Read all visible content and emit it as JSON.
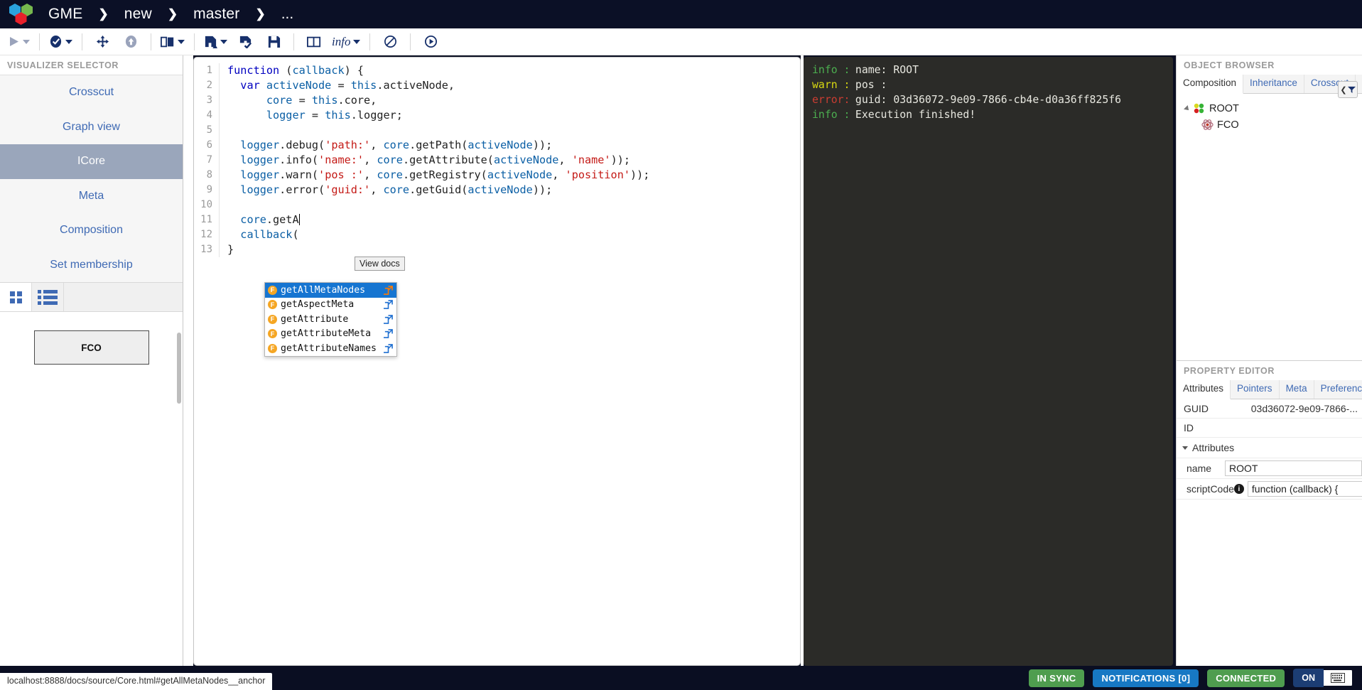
{
  "navbar": {
    "brand": "GME",
    "breadcrumb": [
      "new",
      "master"
    ],
    "overflow": "...",
    "separator": "❯"
  },
  "toolbar": {
    "buttons": [
      {
        "name": "execute-button",
        "icon": "play-icon",
        "label": "",
        "caret": true,
        "disabled": true
      },
      {
        "name": "validate-button",
        "icon": "check-circle-icon",
        "label": "",
        "caret": true,
        "disabled": false
      },
      {
        "name": "move-button",
        "icon": "move-arrows-icon",
        "label": "",
        "caret": false,
        "disabled": false
      },
      {
        "name": "upload-button",
        "icon": "up-circle-icon",
        "label": "",
        "caret": false,
        "disabled": true
      },
      {
        "name": "split-view-button",
        "icon": "split-panel-icon",
        "label": "",
        "caret": true,
        "disabled": false
      },
      {
        "name": "save-as-button",
        "icon": "save-up-icon",
        "label": "",
        "caret": true,
        "disabled": false
      },
      {
        "name": "save-check-button",
        "icon": "save-check-icon",
        "label": "",
        "caret": false,
        "disabled": false
      },
      {
        "name": "save-button",
        "icon": "floppy-save-icon",
        "label": "",
        "caret": false,
        "disabled": false
      },
      {
        "name": "layout-button",
        "icon": "two-column-icon",
        "label": "",
        "caret": false,
        "disabled": false
      },
      {
        "name": "log-level-button",
        "icon": "",
        "label": "info",
        "caret": true,
        "disabled": false
      },
      {
        "name": "clear-console-button",
        "icon": "no-entry-icon",
        "label": "",
        "caret": false,
        "disabled": false
      },
      {
        "name": "run-button",
        "icon": "play-circle-icon",
        "label": "",
        "caret": false,
        "disabled": false
      }
    ]
  },
  "left_panel": {
    "title": "VISUALIZER SELECTOR",
    "items": [
      {
        "label": "Crosscut",
        "active": false
      },
      {
        "label": "Graph view",
        "active": false
      },
      {
        "label": "ICore",
        "active": true
      },
      {
        "label": "Meta",
        "active": false
      },
      {
        "label": "Composition",
        "active": false
      },
      {
        "label": "Set membership",
        "active": false
      }
    ],
    "mode_tabs": [
      {
        "name": "grid-view-tab",
        "icon": "grid-icon",
        "active": true
      },
      {
        "name": "list-view-tab",
        "icon": "list-icon",
        "active": false
      }
    ],
    "node_box": "FCO"
  },
  "editor": {
    "lines": [
      {
        "n": "1",
        "tokens": [
          {
            "t": "function ",
            "c": "k-kw"
          },
          {
            "t": "(",
            "c": "k-plain"
          },
          {
            "t": "callback",
            "c": "k-var"
          },
          {
            "t": ") {",
            "c": "k-plain"
          }
        ]
      },
      {
        "n": "2",
        "tokens": [
          {
            "t": "  ",
            "c": "k-plain"
          },
          {
            "t": "var ",
            "c": "k-kw"
          },
          {
            "t": "activeNode",
            "c": "k-var"
          },
          {
            "t": " = ",
            "c": "k-plain"
          },
          {
            "t": "this",
            "c": "k-this"
          },
          {
            "t": ".activeNode,",
            "c": "k-plain"
          }
        ]
      },
      {
        "n": "3",
        "tokens": [
          {
            "t": "      ",
            "c": "k-plain"
          },
          {
            "t": "core",
            "c": "k-var"
          },
          {
            "t": " = ",
            "c": "k-plain"
          },
          {
            "t": "this",
            "c": "k-this"
          },
          {
            "t": ".core,",
            "c": "k-plain"
          }
        ]
      },
      {
        "n": "4",
        "tokens": [
          {
            "t": "      ",
            "c": "k-plain"
          },
          {
            "t": "logger",
            "c": "k-var"
          },
          {
            "t": " = ",
            "c": "k-plain"
          },
          {
            "t": "this",
            "c": "k-this"
          },
          {
            "t": ".logger;",
            "c": "k-plain"
          }
        ]
      },
      {
        "n": "5",
        "tokens": [
          {
            "t": "",
            "c": "k-plain"
          }
        ]
      },
      {
        "n": "6",
        "tokens": [
          {
            "t": "  ",
            "c": "k-plain"
          },
          {
            "t": "logger",
            "c": "k-var"
          },
          {
            "t": ".debug(",
            "c": "k-plain"
          },
          {
            "t": "'path:'",
            "c": "k-str"
          },
          {
            "t": ", ",
            "c": "k-plain"
          },
          {
            "t": "core",
            "c": "k-var"
          },
          {
            "t": ".getPath(",
            "c": "k-plain"
          },
          {
            "t": "activeNode",
            "c": "k-var"
          },
          {
            "t": "));",
            "c": "k-plain"
          }
        ]
      },
      {
        "n": "7",
        "tokens": [
          {
            "t": "  ",
            "c": "k-plain"
          },
          {
            "t": "logger",
            "c": "k-var"
          },
          {
            "t": ".info(",
            "c": "k-plain"
          },
          {
            "t": "'name:'",
            "c": "k-str"
          },
          {
            "t": ", ",
            "c": "k-plain"
          },
          {
            "t": "core",
            "c": "k-var"
          },
          {
            "t": ".getAttribute(",
            "c": "k-plain"
          },
          {
            "t": "activeNode",
            "c": "k-var"
          },
          {
            "t": ", ",
            "c": "k-plain"
          },
          {
            "t": "'name'",
            "c": "k-str"
          },
          {
            "t": "));",
            "c": "k-plain"
          }
        ]
      },
      {
        "n": "8",
        "tokens": [
          {
            "t": "  ",
            "c": "k-plain"
          },
          {
            "t": "logger",
            "c": "k-var"
          },
          {
            "t": ".warn(",
            "c": "k-plain"
          },
          {
            "t": "'pos :'",
            "c": "k-str"
          },
          {
            "t": ", ",
            "c": "k-plain"
          },
          {
            "t": "core",
            "c": "k-var"
          },
          {
            "t": ".getRegistry(",
            "c": "k-plain"
          },
          {
            "t": "activeNode",
            "c": "k-var"
          },
          {
            "t": ", ",
            "c": "k-plain"
          },
          {
            "t": "'position'",
            "c": "k-str"
          },
          {
            "t": "));",
            "c": "k-plain"
          }
        ]
      },
      {
        "n": "9",
        "tokens": [
          {
            "t": "  ",
            "c": "k-plain"
          },
          {
            "t": "logger",
            "c": "k-var"
          },
          {
            "t": ".error(",
            "c": "k-plain"
          },
          {
            "t": "'guid:'",
            "c": "k-str"
          },
          {
            "t": ", ",
            "c": "k-plain"
          },
          {
            "t": "core",
            "c": "k-var"
          },
          {
            "t": ".getGuid(",
            "c": "k-plain"
          },
          {
            "t": "activeNode",
            "c": "k-var"
          },
          {
            "t": "));",
            "c": "k-plain"
          }
        ]
      },
      {
        "n": "10",
        "tokens": [
          {
            "t": "",
            "c": "k-plain"
          }
        ]
      },
      {
        "n": "11",
        "tokens": [
          {
            "t": "  ",
            "c": "k-plain"
          },
          {
            "t": "core",
            "c": "k-var"
          },
          {
            "t": ".getA",
            "c": "k-plain"
          },
          {
            "t": "|CARET|",
            "c": "caret"
          }
        ]
      },
      {
        "n": "12",
        "tokens": [
          {
            "t": "  ",
            "c": "k-plain"
          },
          {
            "t": "callback",
            "c": "k-var"
          },
          {
            "t": "(",
            "c": "k-plain"
          }
        ]
      },
      {
        "n": "13",
        "tokens": [
          {
            "t": "}",
            "c": "k-plain"
          }
        ]
      }
    ],
    "autocomplete": {
      "items": [
        {
          "label": "getAllMetaNodes",
          "kind": "F",
          "selected": true
        },
        {
          "label": "getAspectMeta",
          "kind": "F",
          "selected": false
        },
        {
          "label": "getAttribute",
          "kind": "F",
          "selected": false
        },
        {
          "label": "getAttributeMeta",
          "kind": "F",
          "selected": false
        },
        {
          "label": "getAttributeNames",
          "kind": "F",
          "selected": false
        }
      ],
      "tooltip": "View docs"
    }
  },
  "console": {
    "lines": [
      {
        "level": "info",
        "level_text": "info :",
        "message": " name: ROOT"
      },
      {
        "level": "warn",
        "level_text": "warn :",
        "message": " pos :"
      },
      {
        "level": "error",
        "level_text": "error:",
        "message": " guid: 03d36072-9e09-7866-cb4e-d0a36ff825f6"
      },
      {
        "level": "info",
        "level_text": "info :",
        "message": " Execution finished!"
      }
    ]
  },
  "object_browser": {
    "title": "OBJECT BROWSER",
    "tabs": [
      {
        "label": "Composition",
        "active": true
      },
      {
        "label": "Inheritance",
        "active": false
      },
      {
        "label": "Crosscut",
        "active": false
      }
    ],
    "filter_button": "❮",
    "tree": [
      {
        "label": "ROOT",
        "depth": 0,
        "icon": "root-node-icon",
        "expanded": true
      },
      {
        "label": "FCO",
        "depth": 1,
        "icon": "fco-node-icon",
        "expanded": false
      }
    ]
  },
  "property_editor": {
    "title": "PROPERTY EDITOR",
    "tabs": [
      {
        "label": "Attributes",
        "active": true
      },
      {
        "label": "Pointers",
        "active": false
      },
      {
        "label": "Meta",
        "active": false
      },
      {
        "label": "Preferences",
        "active": false
      }
    ],
    "rows": [
      {
        "key": "GUID",
        "value": "03d36072-9e09-7866-..."
      },
      {
        "key": "ID",
        "value": ""
      }
    ],
    "group_label": "Attributes",
    "attributes": [
      {
        "key": "name",
        "value": "ROOT",
        "info": false
      },
      {
        "key": "scriptCode",
        "value": "function (callback) {",
        "info": true
      }
    ]
  },
  "status_bar": {
    "sync": "IN SYNC",
    "notifications": "NOTIFICATIONS [0]",
    "connected": "CONNECTED",
    "toggle_on": "ON",
    "keyboard_icon": "keyboard-icon"
  },
  "url_status": "localhost:8888/docs/source/Core.html#getAllMetaNodes__anchor",
  "colors": {
    "accent": "#17306b",
    "selection": "#1675d1",
    "green": "#4f9d4f",
    "blue": "#1778c4"
  }
}
